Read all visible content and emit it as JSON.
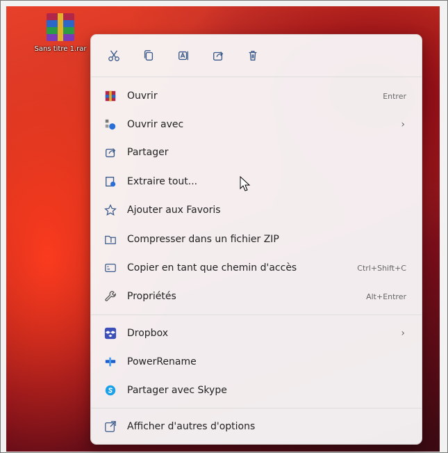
{
  "desktop": {
    "file_label": "Sans titre 1.rar",
    "background_text": ""
  },
  "toolbar": {
    "icons": [
      "cut-icon",
      "copy-icon",
      "rename-icon",
      "share-icon",
      "delete-icon"
    ]
  },
  "menu": {
    "items": [
      {
        "label": "Ouvrir",
        "shortcut": "Entrer",
        "icon": "rar-icon"
      },
      {
        "label": "Ouvrir avec",
        "shortcut": "",
        "icon": "open-with-icon",
        "submenu": "›"
      },
      {
        "label": "Partager",
        "shortcut": "",
        "icon": "share-icon"
      },
      {
        "label": "Extraire tout...",
        "shortcut": "",
        "icon": "extract-icon"
      },
      {
        "label": "Ajouter aux Favoris",
        "shortcut": "",
        "icon": "star-icon"
      },
      {
        "label": "Compresser dans un fichier ZIP",
        "shortcut": "",
        "icon": "zip-icon"
      },
      {
        "label": "Copier en tant que chemin d'accès",
        "shortcut": "Ctrl+Shift+C",
        "icon": "path-icon"
      },
      {
        "label": "Propriétés",
        "shortcut": "Alt+Entrer",
        "icon": "wrench-icon"
      },
      {
        "label": "Dropbox",
        "shortcut": "",
        "icon": "dropbox-icon",
        "submenu": "›"
      },
      {
        "label": "PowerRename",
        "shortcut": "",
        "icon": "powerrename-icon"
      },
      {
        "label": "Partager avec Skype",
        "shortcut": "",
        "icon": "skype-icon"
      },
      {
        "label": "Afficher d'autres d'options",
        "shortcut": "",
        "icon": "more-options-icon"
      }
    ]
  },
  "colors": {
    "accent": "#3a5a8a",
    "menu_bg": "#f8f6f7"
  }
}
